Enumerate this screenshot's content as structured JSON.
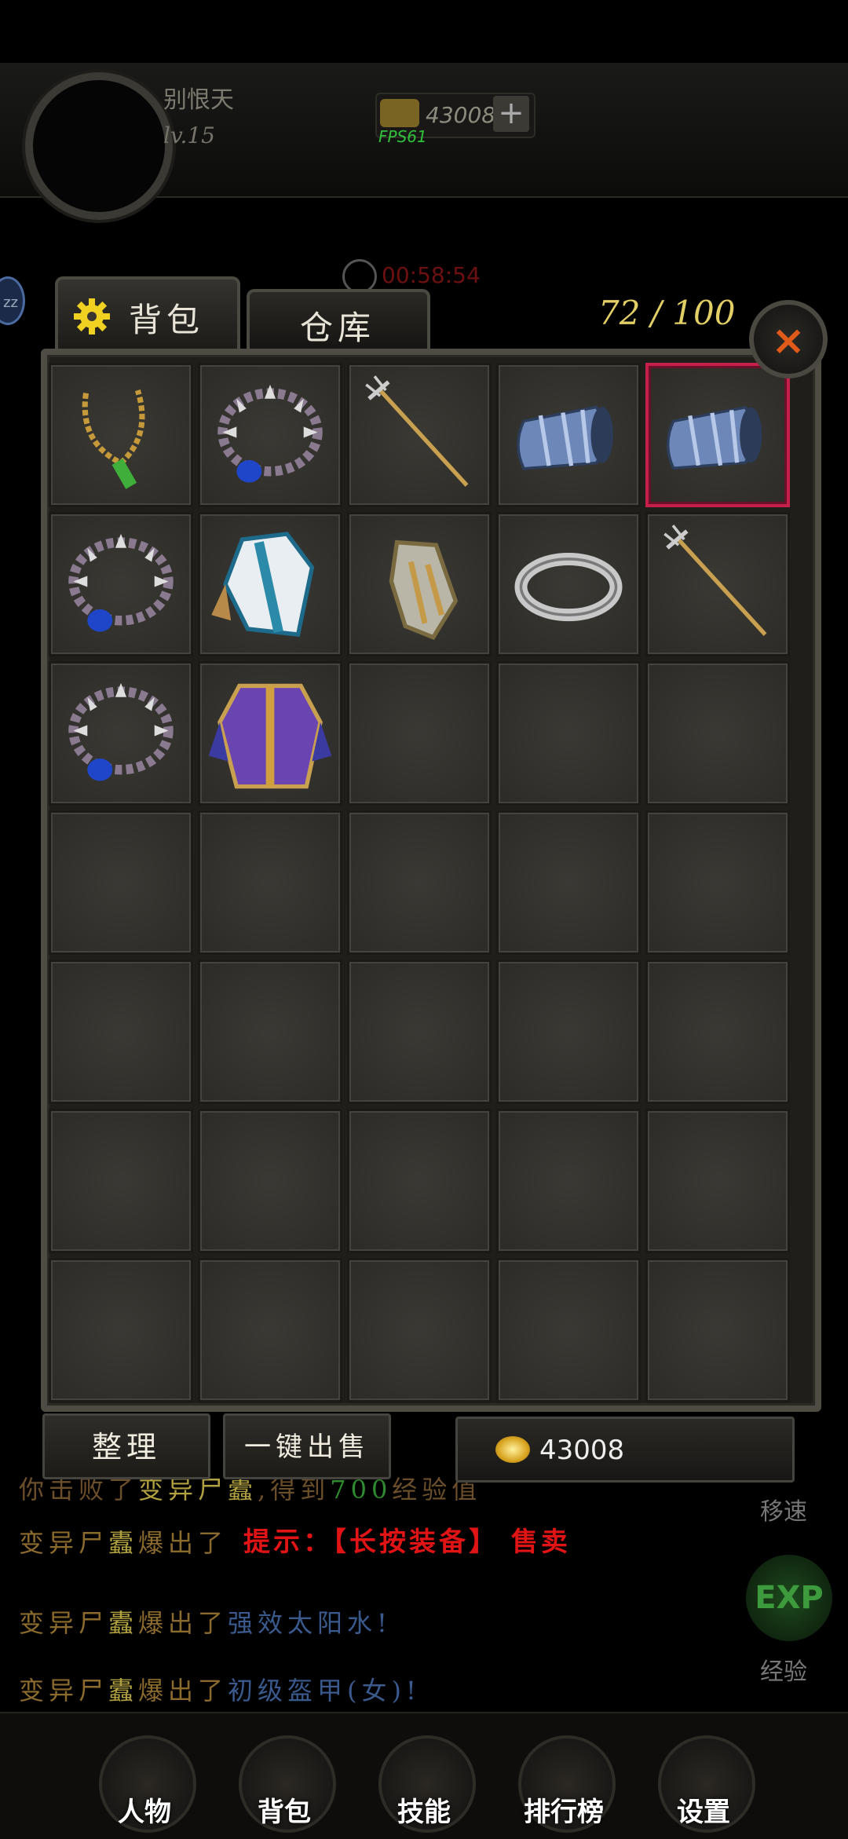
{
  "player": {
    "name": "别恨天",
    "level": "lv.15"
  },
  "currency": {
    "gold_top": "43008",
    "plus": "+",
    "fps": "FPS61"
  },
  "timer": {
    "text": "00:58:54"
  },
  "side_badge": "zz",
  "bag": {
    "tab_bag": "背包",
    "tab_storage": "仓库",
    "capacity": "72 / 100",
    "close": "×",
    "slots": [
      {
        "item": "necklace-gold",
        "selected": false
      },
      {
        "item": "spiked-bead-necklace",
        "selected": false
      },
      {
        "item": "trident",
        "selected": false
      },
      {
        "item": "bracer",
        "selected": false
      },
      {
        "item": "bracer",
        "selected": true
      },
      {
        "item": "spiked-bead-necklace",
        "selected": false
      },
      {
        "item": "white-blue-robe",
        "selected": false
      },
      {
        "item": "gauntlet",
        "selected": false
      },
      {
        "item": "silver-ring",
        "selected": false
      },
      {
        "item": "trident",
        "selected": false
      },
      {
        "item": "spiked-bead-necklace",
        "selected": false
      },
      {
        "item": "purple-armor",
        "selected": false
      },
      {
        "item": null
      },
      {
        "item": null
      },
      {
        "item": null
      },
      {
        "item": null
      },
      {
        "item": null
      },
      {
        "item": null
      },
      {
        "item": null
      },
      {
        "item": null
      },
      {
        "item": null
      },
      {
        "item": null
      },
      {
        "item": null
      },
      {
        "item": null
      },
      {
        "item": null
      },
      {
        "item": null
      },
      {
        "item": null
      },
      {
        "item": null
      },
      {
        "item": null
      },
      {
        "item": null
      },
      {
        "item": null
      },
      {
        "item": null
      },
      {
        "item": null
      },
      {
        "item": null
      },
      {
        "item": null
      }
    ],
    "sort_button": "整理",
    "sell_all_button": "一键出售",
    "gold_amount": "43008",
    "tip": "提示：【长按装备】 售卖"
  },
  "chat": {
    "line1": {
      "pre": "你击败了",
      "mon": "变异尸蠹",
      "mid": ",得到",
      "num": "700",
      "post": "经验值"
    },
    "line2": {
      "pre": "变异尸",
      "mon": "蠹",
      "mid": "爆出了",
      "item": ""
    },
    "line3": {
      "pre": "变异尸",
      "mon": "蠹",
      "mid": "爆出了",
      "item": "强效太阳水!"
    },
    "line4": {
      "pre": "变异尸",
      "mon": "蠹",
      "mid": "爆出了",
      "item": "初级盔甲(女)!"
    }
  },
  "side_right": {
    "speed": "移速",
    "exp_label": "经验",
    "exp_icon": "EXP"
  },
  "nav": [
    "人物",
    "背包",
    "技能",
    "排行榜",
    "设置"
  ],
  "colors": {
    "accent_red": "#c4204a",
    "tip_red": "#e01414",
    "capacity_yellow": "#e2cf66",
    "close_orange": "#e05a1a"
  }
}
